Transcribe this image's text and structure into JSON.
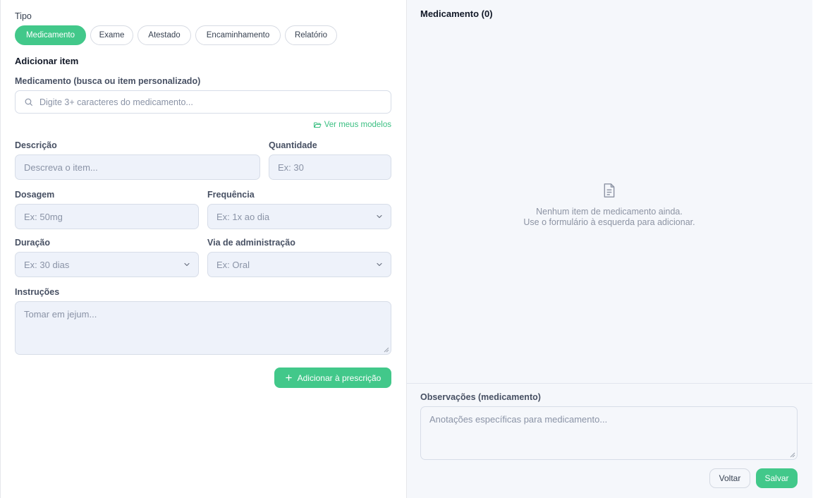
{
  "form": {
    "tipo_label": "Tipo",
    "tipos": [
      {
        "label": "Medicamento",
        "active": true
      },
      {
        "label": "Exame",
        "active": false
      },
      {
        "label": "Atestado",
        "active": false
      },
      {
        "label": "Encaminhamento",
        "active": false
      },
      {
        "label": "Relatório",
        "active": false
      }
    ],
    "add_item_title": "Adicionar item",
    "medicamento_label": "Medicamento (busca ou item personalizado)",
    "search_placeholder": "Digite 3+ caracteres do medicamento...",
    "models_link": "Ver meus modelos",
    "descricao_label": "Descrição",
    "descricao_placeholder": "Descreva o item...",
    "quantidade_label": "Quantidade",
    "quantidade_placeholder": "Ex: 30",
    "dosagem_label": "Dosagem",
    "dosagem_placeholder": "Ex: 50mg",
    "frequencia_label": "Frequência",
    "frequencia_value": "Ex: 1x ao dia",
    "duracao_label": "Duração",
    "duracao_value": "Ex: 30 dias",
    "via_label": "Via de administração",
    "via_value": "Ex: Oral",
    "instrucoes_label": "Instruções",
    "instrucoes_placeholder": "Tomar em jejum...",
    "add_button": "Adicionar à prescrição"
  },
  "list": {
    "title": "Medicamento (0)",
    "empty_line1": "Nenhum item de medicamento ainda.",
    "empty_line2": "Use o formulário à esquerda para adicionar."
  },
  "observacoes": {
    "label": "Observações (medicamento)",
    "placeholder": "Anotações específicas para medicamento..."
  },
  "footer": {
    "back_label": "Voltar",
    "save_label": "Salvar"
  },
  "icons": {
    "search": "search-icon",
    "folder": "folder-open-icon",
    "chevron": "chevron-down-icon",
    "plus": "plus-icon",
    "document": "document-icon"
  },
  "colors": {
    "accent": "#42c88a",
    "field_bg": "#eef2fa",
    "panel_bg": "#f5f7fb"
  }
}
